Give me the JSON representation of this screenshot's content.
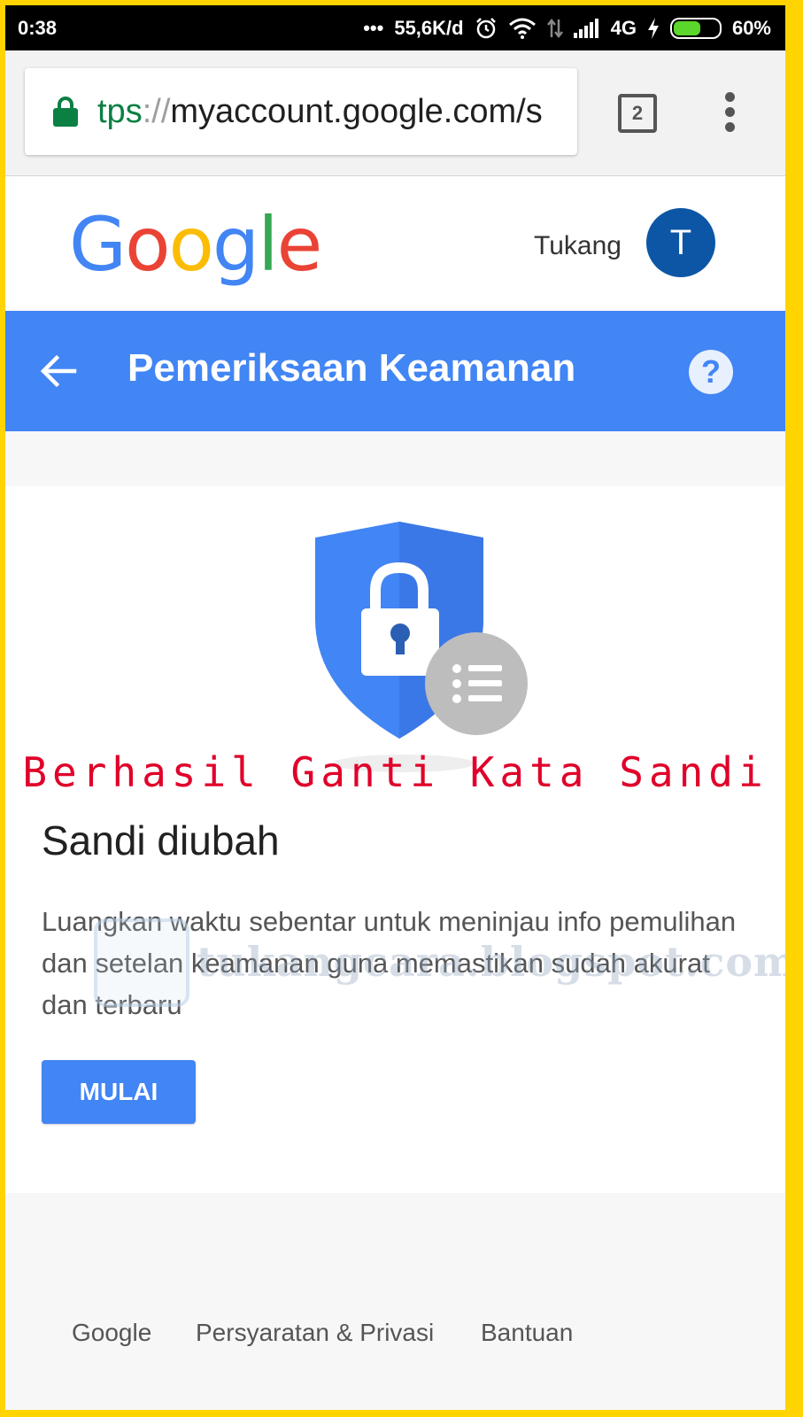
{
  "status_bar": {
    "time": "0:38",
    "network_speed": "55,6K/d",
    "network_type": "4G",
    "battery_percent": "60%",
    "battery_level": 0.6,
    "icons": [
      "dots-icon",
      "alarm-icon",
      "wifi-icon",
      "data-arrows-icon",
      "signal-icon",
      "charging-icon",
      "battery-icon"
    ]
  },
  "browser": {
    "url_scheme": "tps",
    "url_sep": "://",
    "url_host": "myaccount.google.com/s",
    "tab_count": "2"
  },
  "header": {
    "logo_letters": [
      "G",
      "o",
      "o",
      "g",
      "l",
      "e"
    ],
    "logo_colors": [
      "#4285f4",
      "#ea4335",
      "#fbbc05",
      "#4285f4",
      "#34a853",
      "#ea4335"
    ],
    "username": "Tukang",
    "avatar_initial": "T",
    "avatar_color": "#0c56a5"
  },
  "appbar": {
    "title": "Pemeriksaan Keamanan",
    "help": "?",
    "color": "#4285f4"
  },
  "card": {
    "caption": "Berhasil Ganti Kata Sandi",
    "title": "Sandi diubah",
    "body": "Luangkan waktu sebentar untuk meninjau info pemulihan dan setelan keamanan guna memastikan sudah akurat dan terbaru",
    "button": "MULAI",
    "watermark": "tukangcara.blogspot.com"
  },
  "footer": {
    "links": [
      "Google",
      "Persyaratan & Privasi",
      "Bantuan"
    ]
  }
}
